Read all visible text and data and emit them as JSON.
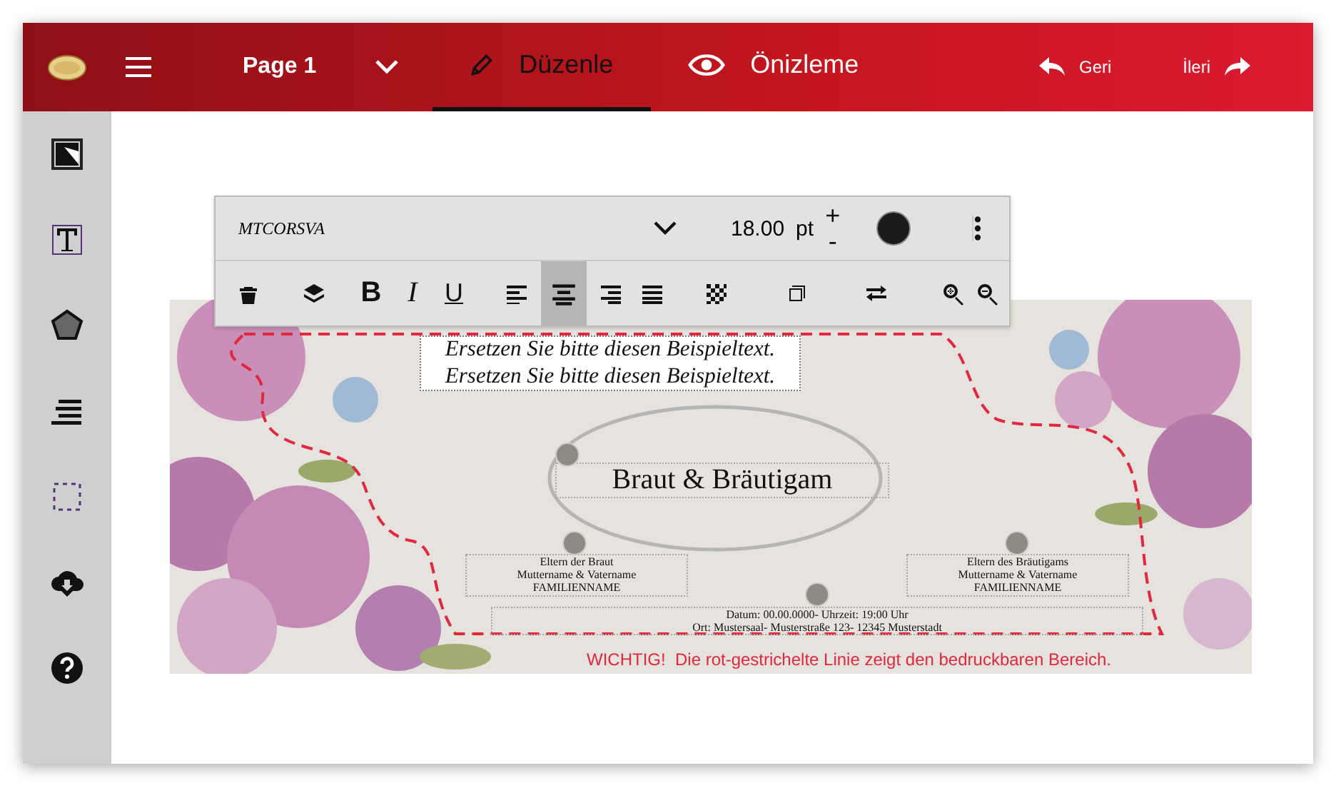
{
  "header": {
    "page_label": "Page 1",
    "tabs": [
      {
        "kind": "edit",
        "label": "Düzenle",
        "selected": true
      },
      {
        "kind": "preview",
        "label": "Önizleme",
        "selected": false
      }
    ],
    "undo": "Geri",
    "redo": "İleri"
  },
  "sidebar": {
    "tools": [
      {
        "kind": "image"
      },
      {
        "kind": "text"
      },
      {
        "kind": "shape"
      },
      {
        "kind": "lines"
      },
      {
        "kind": "frame"
      },
      {
        "kind": "download"
      },
      {
        "kind": "help"
      }
    ]
  },
  "toolbar": {
    "font": "MTCORSVA",
    "size": "18.00",
    "unit": "pt",
    "increase": "+",
    "decrease": "-",
    "buttons": [
      {
        "kind": "delete",
        "selected": false
      },
      {
        "kind": "layers",
        "selected": false
      },
      {
        "kind": "bold",
        "label": "B",
        "selected": false
      },
      {
        "kind": "italic",
        "label": "I",
        "selected": false
      },
      {
        "kind": "underline",
        "label": "U",
        "selected": false
      },
      {
        "kind": "align-left",
        "selected": false
      },
      {
        "kind": "align-center",
        "selected": true
      },
      {
        "kind": "align-right",
        "selected": false
      },
      {
        "kind": "justify",
        "selected": false
      },
      {
        "kind": "transparency",
        "selected": false
      },
      {
        "kind": "crop",
        "selected": false
      },
      {
        "kind": "swap",
        "selected": false
      },
      {
        "kind": "zoom-in",
        "selected": false
      },
      {
        "kind": "zoom-out",
        "selected": false
      }
    ]
  },
  "card": {
    "top_text": [
      "Ersetzen Sie bitte diesen Beispieltext.",
      "Ersetzen Sie bitte diesen Beispieltext."
    ],
    "title": "Braut & Bräutigam",
    "bride_parents": [
      "Eltern der Braut",
      "Muttername & Vatername",
      "FAMILIENNAME"
    ],
    "groom_parents": [
      "Eltern des Bräutigams",
      "Muttername & Vatername",
      "FAMILIENNAME"
    ],
    "details": [
      "Datum: 00.00.0000- Uhrzeit: 19:00 Uhr",
      "Ort: Mustersaal- Musterstraße 123- 12345 Musterstadt"
    ],
    "notice": "WICHTIG!  Die rot-gestrichelte Linie zeigt den bedruckbaren Bereich."
  }
}
